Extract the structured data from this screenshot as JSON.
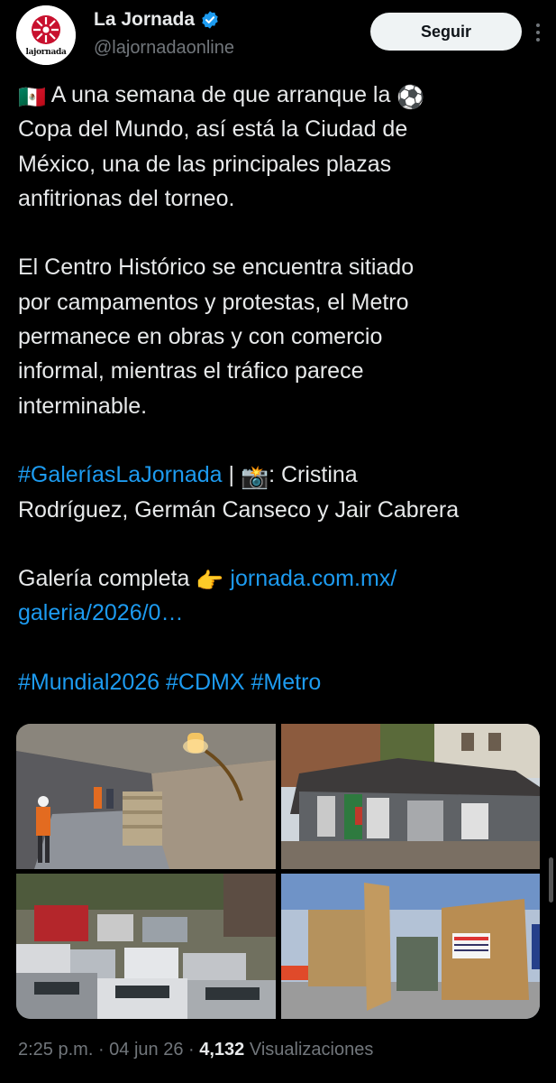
{
  "account": {
    "name": "La Jornada",
    "handle": "@lajornadaonline",
    "avatar_text": "lajornada",
    "verified": true
  },
  "follow_button": {
    "label": "Seguir"
  },
  "tweet": {
    "lines": [
      {
        "emoji": "🇲🇽",
        "text": " A una semana de que arranque la ",
        "emoji_after": "⚽"
      },
      {
        "text": "Copa del Mundo, así está la Ciudad de"
      },
      {
        "text": "México, una de las principales plazas"
      },
      {
        "text": "anfitrionas del torneo."
      },
      {
        "text": ""
      },
      {
        "text": "El Centro Histórico se encuentra sitiado"
      },
      {
        "text": "por campamentos y protestas, el Metro"
      },
      {
        "text": "permanece en obras y con comercio"
      },
      {
        "text": "informal, mientras el tráfico parece"
      },
      {
        "text": "interminable."
      }
    ],
    "gallery_tag": "#GaleríasLaJornada",
    "credit_sep": " | ",
    "camera_emoji": "📸",
    "credit_prefix": ": Cristina",
    "credit_line2": "Rodríguez, Germán Canseco y Jair Cabrera",
    "full_gallery_label": "Galería completa ",
    "pointing_emoji": "👉",
    "link_line1": "jornada.com.mx/",
    "link_line2": "galeria/2026/0…",
    "hashtags": [
      "#Mundial2026",
      "#CDMX",
      "#Metro"
    ]
  },
  "meta": {
    "time": "2:25 p.m.",
    "sep": " · ",
    "date": "04 jun 26",
    "views_count": "4,132",
    "views_label": " Visualizaciones"
  },
  "colors": {
    "background": "#000000",
    "text": "#e7e9ea",
    "muted": "#71767b",
    "link": "#1d9bf0",
    "verified": "#1d9bf0"
  }
}
